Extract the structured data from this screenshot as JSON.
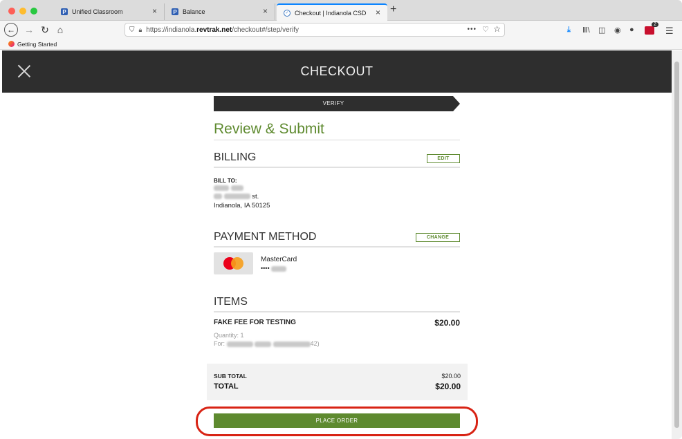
{
  "browser": {
    "tabs": [
      {
        "label": "Unified Classroom",
        "favicon": "P"
      },
      {
        "label": "Balance",
        "favicon": "P"
      },
      {
        "label": "Checkout | Indianola CSD",
        "favicon": "revtrak-icon"
      }
    ],
    "url_prefix": "https://indianola.",
    "url_domain": "revtrak.net",
    "url_suffix": "/checkout#/step/verify",
    "bookmark": "Getting Started",
    "ext_badge": "2"
  },
  "header": {
    "title": "CHECKOUT"
  },
  "checkout": {
    "step_label": "VERIFY",
    "review_title": "Review & Submit",
    "billing": {
      "title": "BILLING",
      "edit_label": "EDIT",
      "bill_to_label": "BILL TO:",
      "line2_suffix": "st.",
      "city_line": "Indianola, IA 50125"
    },
    "payment": {
      "title": "PAYMENT METHOD",
      "change_label": "CHANGE",
      "card_name": "MasterCard",
      "card_mask": "••••"
    },
    "items": {
      "title": "ITEMS",
      "name": "FAKE FEE FOR TESTING",
      "price": "$20.00",
      "quantity": "Quantity: 1",
      "for_prefix": "For:",
      "for_suffix": "42)"
    },
    "totals": {
      "sub_label": "SUB TOTAL",
      "sub_value": "$20.00",
      "total_label": "TOTAL",
      "total_value": "$20.00"
    },
    "place_order_label": "PLACE ORDER"
  },
  "colors": {
    "accent_green": "#5e8a2f",
    "header_dark": "#2e2e2e",
    "highlight_red": "#d82314"
  }
}
